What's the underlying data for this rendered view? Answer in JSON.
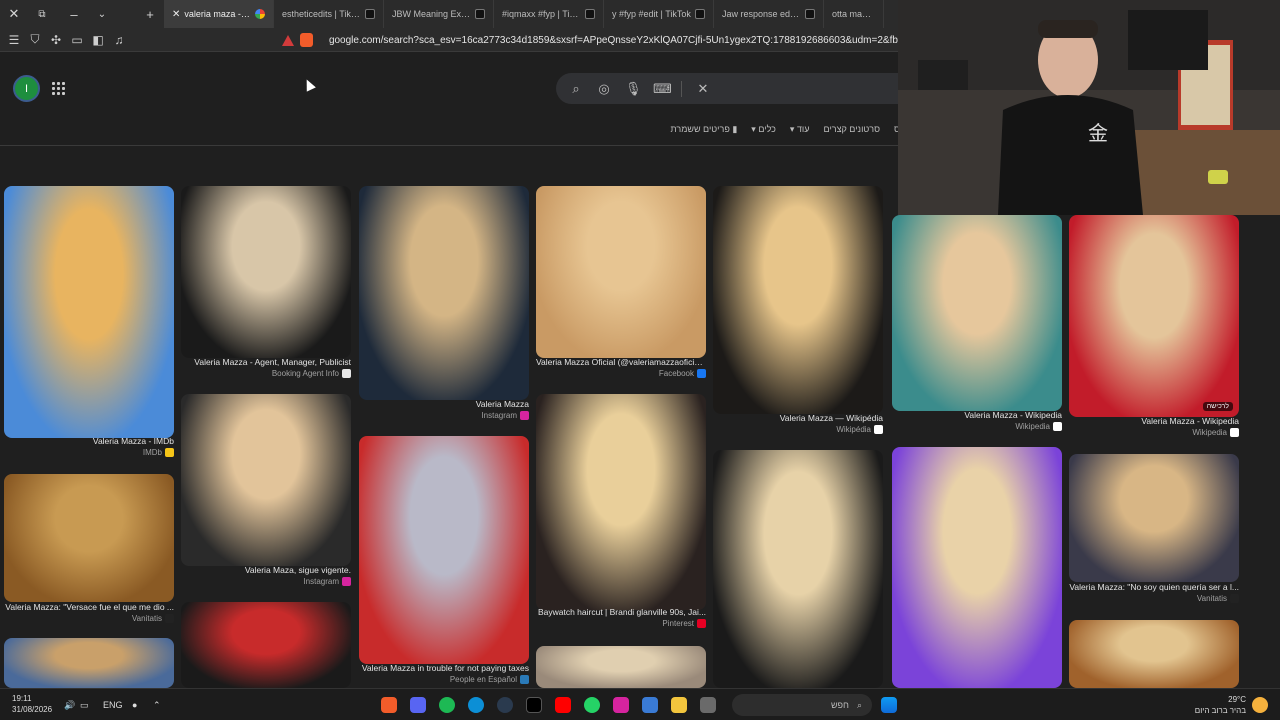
{
  "tabs": [
    {
      "label": "valeria maza - כ v",
      "active": true
    },
    {
      "label": "estheticedits | TikTok",
      "active": false
    },
    {
      "label": "JBW Meaning Explaine",
      "active": false
    },
    {
      "label": "#iqmaxx #fyp | TikTok",
      "active": false
    },
    {
      "label": "y #fyp #edit | TikTok",
      "active": false
    },
    {
      "label": "Jaw response edit — ",
      "active": false
    },
    {
      "label": "otta make a...",
      "active": false
    }
  ],
  "url": "google.com/search?sca_esv=16ca2773c34d1859&sxsrf=APpeQnsseY2xKlQA07Cjfi-5Un1ygex2TQ:1788192686603&udm=2&fbs=ABfTbFV",
  "avatar_letter": "I",
  "filters": [
    "ס",
    "סרטונים קצרים",
    "עוד",
    "כלים",
    "פריטים ששמרת"
  ],
  "images": [
    {
      "caption": "Valeria Mazza - IMDb",
      "source": "IMDb",
      "icon_color": "#f5c518"
    },
    {
      "caption": "Valeria Mazza: \"Versace fue el que me dio ...",
      "source": "Vanitatis",
      "icon_color": "#222222"
    },
    {
      "caption": "Valeria Mazza - Agent, Manager, Publicist",
      "source": "Booking Agent Info",
      "icon_color": "#e6e6e6"
    },
    {
      "caption": "Valeria Maza, sigue vigente.",
      "source": "Instagram",
      "icon_color": "#d6249f"
    },
    {
      "caption": "Valeria Mazza",
      "source": "Instagram",
      "icon_color": "#d6249f"
    },
    {
      "caption": "Valeria Mazza in trouble for not paying taxes",
      "source": "People en Español",
      "icon_color": "#2a7ab8"
    },
    {
      "caption": "Valeria Mazza Oficial (@valeriamazzaoficial...",
      "source": "Facebook",
      "icon_color": "#1877f2"
    },
    {
      "caption": "Baywatch haircut | Brandi glanville 90s, Jai...",
      "source": "Pinterest",
      "icon_color": "#e60023"
    },
    {
      "caption": "Valeria Mazza — Wikipédia",
      "source": "Wikipédia",
      "icon_color": "#ffffff"
    },
    {
      "caption": "Valeria Mazza - Wikipedia",
      "source": "Wikipedia",
      "icon_color": "#ffffff"
    },
    {
      "caption": "Valeria Mazza - Wikipedia",
      "source": "Wikipedia",
      "icon_color": "#ffffff"
    },
    {
      "caption": "Valeria Mazza: \"No soy quien quería ser a l...",
      "source": "Vanitatis",
      "icon_color": "#222222"
    }
  ],
  "image_badge": "לרכישה",
  "taskbar": {
    "time": "19:11",
    "date": "31/08/2026",
    "lang": "ENG",
    "search_placeholder": "חפש",
    "temp": "29°C",
    "weather": "בהיר ברוב היום"
  }
}
